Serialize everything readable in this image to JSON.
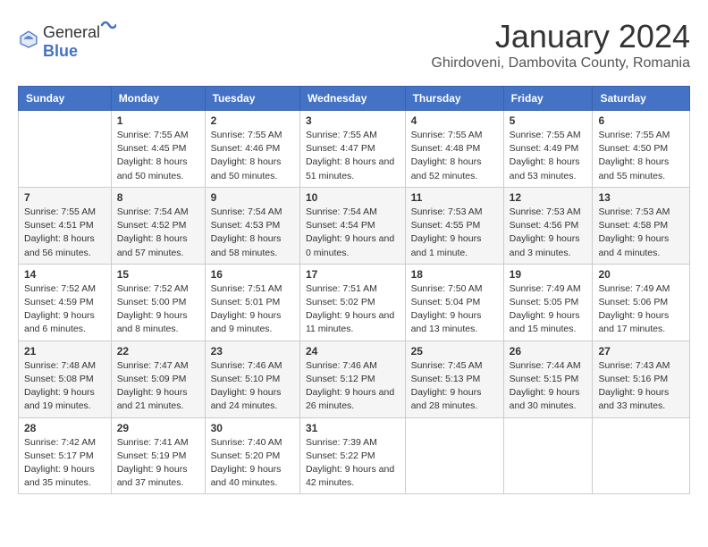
{
  "header": {
    "logo_general": "General",
    "logo_blue": "Blue",
    "title": "January 2024",
    "subtitle": "Ghirdoveni, Dambovita County, Romania"
  },
  "columns": [
    "Sunday",
    "Monday",
    "Tuesday",
    "Wednesday",
    "Thursday",
    "Friday",
    "Saturday"
  ],
  "weeks": [
    [
      {
        "day": "",
        "sunrise": "",
        "sunset": "",
        "daylight": ""
      },
      {
        "day": "1",
        "sunrise": "Sunrise: 7:55 AM",
        "sunset": "Sunset: 4:45 PM",
        "daylight": "Daylight: 8 hours and 50 minutes."
      },
      {
        "day": "2",
        "sunrise": "Sunrise: 7:55 AM",
        "sunset": "Sunset: 4:46 PM",
        "daylight": "Daylight: 8 hours and 50 minutes."
      },
      {
        "day": "3",
        "sunrise": "Sunrise: 7:55 AM",
        "sunset": "Sunset: 4:47 PM",
        "daylight": "Daylight: 8 hours and 51 minutes."
      },
      {
        "day": "4",
        "sunrise": "Sunrise: 7:55 AM",
        "sunset": "Sunset: 4:48 PM",
        "daylight": "Daylight: 8 hours and 52 minutes."
      },
      {
        "day": "5",
        "sunrise": "Sunrise: 7:55 AM",
        "sunset": "Sunset: 4:49 PM",
        "daylight": "Daylight: 8 hours and 53 minutes."
      },
      {
        "day": "6",
        "sunrise": "Sunrise: 7:55 AM",
        "sunset": "Sunset: 4:50 PM",
        "daylight": "Daylight: 8 hours and 55 minutes."
      }
    ],
    [
      {
        "day": "7",
        "sunrise": "Sunrise: 7:55 AM",
        "sunset": "Sunset: 4:51 PM",
        "daylight": "Daylight: 8 hours and 56 minutes."
      },
      {
        "day": "8",
        "sunrise": "Sunrise: 7:54 AM",
        "sunset": "Sunset: 4:52 PM",
        "daylight": "Daylight: 8 hours and 57 minutes."
      },
      {
        "day": "9",
        "sunrise": "Sunrise: 7:54 AM",
        "sunset": "Sunset: 4:53 PM",
        "daylight": "Daylight: 8 hours and 58 minutes."
      },
      {
        "day": "10",
        "sunrise": "Sunrise: 7:54 AM",
        "sunset": "Sunset: 4:54 PM",
        "daylight": "Daylight: 9 hours and 0 minutes."
      },
      {
        "day": "11",
        "sunrise": "Sunrise: 7:53 AM",
        "sunset": "Sunset: 4:55 PM",
        "daylight": "Daylight: 9 hours and 1 minute."
      },
      {
        "day": "12",
        "sunrise": "Sunrise: 7:53 AM",
        "sunset": "Sunset: 4:56 PM",
        "daylight": "Daylight: 9 hours and 3 minutes."
      },
      {
        "day": "13",
        "sunrise": "Sunrise: 7:53 AM",
        "sunset": "Sunset: 4:58 PM",
        "daylight": "Daylight: 9 hours and 4 minutes."
      }
    ],
    [
      {
        "day": "14",
        "sunrise": "Sunrise: 7:52 AM",
        "sunset": "Sunset: 4:59 PM",
        "daylight": "Daylight: 9 hours and 6 minutes."
      },
      {
        "day": "15",
        "sunrise": "Sunrise: 7:52 AM",
        "sunset": "Sunset: 5:00 PM",
        "daylight": "Daylight: 9 hours and 8 minutes."
      },
      {
        "day": "16",
        "sunrise": "Sunrise: 7:51 AM",
        "sunset": "Sunset: 5:01 PM",
        "daylight": "Daylight: 9 hours and 9 minutes."
      },
      {
        "day": "17",
        "sunrise": "Sunrise: 7:51 AM",
        "sunset": "Sunset: 5:02 PM",
        "daylight": "Daylight: 9 hours and 11 minutes."
      },
      {
        "day": "18",
        "sunrise": "Sunrise: 7:50 AM",
        "sunset": "Sunset: 5:04 PM",
        "daylight": "Daylight: 9 hours and 13 minutes."
      },
      {
        "day": "19",
        "sunrise": "Sunrise: 7:49 AM",
        "sunset": "Sunset: 5:05 PM",
        "daylight": "Daylight: 9 hours and 15 minutes."
      },
      {
        "day": "20",
        "sunrise": "Sunrise: 7:49 AM",
        "sunset": "Sunset: 5:06 PM",
        "daylight": "Daylight: 9 hours and 17 minutes."
      }
    ],
    [
      {
        "day": "21",
        "sunrise": "Sunrise: 7:48 AM",
        "sunset": "Sunset: 5:08 PM",
        "daylight": "Daylight: 9 hours and 19 minutes."
      },
      {
        "day": "22",
        "sunrise": "Sunrise: 7:47 AM",
        "sunset": "Sunset: 5:09 PM",
        "daylight": "Daylight: 9 hours and 21 minutes."
      },
      {
        "day": "23",
        "sunrise": "Sunrise: 7:46 AM",
        "sunset": "Sunset: 5:10 PM",
        "daylight": "Daylight: 9 hours and 24 minutes."
      },
      {
        "day": "24",
        "sunrise": "Sunrise: 7:46 AM",
        "sunset": "Sunset: 5:12 PM",
        "daylight": "Daylight: 9 hours and 26 minutes."
      },
      {
        "day": "25",
        "sunrise": "Sunrise: 7:45 AM",
        "sunset": "Sunset: 5:13 PM",
        "daylight": "Daylight: 9 hours and 28 minutes."
      },
      {
        "day": "26",
        "sunrise": "Sunrise: 7:44 AM",
        "sunset": "Sunset: 5:15 PM",
        "daylight": "Daylight: 9 hours and 30 minutes."
      },
      {
        "day": "27",
        "sunrise": "Sunrise: 7:43 AM",
        "sunset": "Sunset: 5:16 PM",
        "daylight": "Daylight: 9 hours and 33 minutes."
      }
    ],
    [
      {
        "day": "28",
        "sunrise": "Sunrise: 7:42 AM",
        "sunset": "Sunset: 5:17 PM",
        "daylight": "Daylight: 9 hours and 35 minutes."
      },
      {
        "day": "29",
        "sunrise": "Sunrise: 7:41 AM",
        "sunset": "Sunset: 5:19 PM",
        "daylight": "Daylight: 9 hours and 37 minutes."
      },
      {
        "day": "30",
        "sunrise": "Sunrise: 7:40 AM",
        "sunset": "Sunset: 5:20 PM",
        "daylight": "Daylight: 9 hours and 40 minutes."
      },
      {
        "day": "31",
        "sunrise": "Sunrise: 7:39 AM",
        "sunset": "Sunset: 5:22 PM",
        "daylight": "Daylight: 9 hours and 42 minutes."
      },
      {
        "day": "",
        "sunrise": "",
        "sunset": "",
        "daylight": ""
      },
      {
        "day": "",
        "sunrise": "",
        "sunset": "",
        "daylight": ""
      },
      {
        "day": "",
        "sunrise": "",
        "sunset": "",
        "daylight": ""
      }
    ]
  ]
}
